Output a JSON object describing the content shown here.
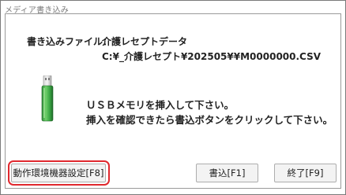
{
  "window": {
    "title": "メディア書き込み"
  },
  "file": {
    "label": "書き込みファイル：",
    "name": "介護レセプトデータ",
    "path": "C:¥_介護レセプト¥202505¥¥M0000000.CSV"
  },
  "message": {
    "line1": "ＵＳＢメモリを挿入して下さい。",
    "line2": "挿入を確認できたら書込ボタンをクリックして下さい。"
  },
  "buttons": {
    "settings": "動作環境機器設定[F8]",
    "write": "書込[F1]",
    "exit": "終了[F9]"
  },
  "icons": {
    "usb": "usb-drive-icon"
  },
  "colors": {
    "highlight": "#e0282e",
    "usb_body": "#3fa84a",
    "usb_connector": "#c8c8c8"
  }
}
